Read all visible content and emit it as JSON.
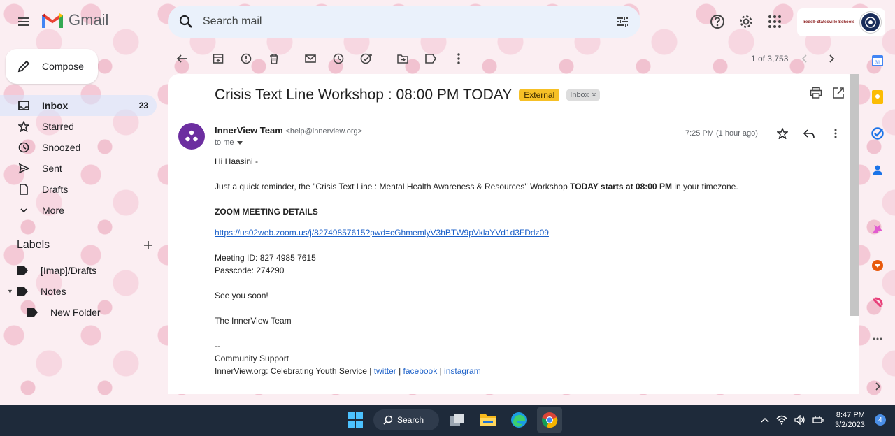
{
  "app": {
    "name": "Gmail"
  },
  "search": {
    "placeholder": "Search mail"
  },
  "account": {
    "school_name": "Iredell-Statesville Schools"
  },
  "nav": {
    "compose_label": "Compose",
    "items": [
      {
        "label": "Inbox",
        "count": "23",
        "icon": "inbox-icon"
      },
      {
        "label": "Starred",
        "icon": "star-icon"
      },
      {
        "label": "Snoozed",
        "icon": "clock-icon"
      },
      {
        "label": "Sent",
        "icon": "send-icon"
      },
      {
        "label": "Drafts",
        "icon": "draft-icon"
      },
      {
        "label": "More",
        "icon": "chevron-down-icon"
      }
    ]
  },
  "labels": {
    "heading": "Labels",
    "items": [
      {
        "label": "[Imap]/Drafts"
      },
      {
        "label": "Notes"
      },
      {
        "label": "New Folder"
      }
    ]
  },
  "pager": {
    "text": "1 of 3,753"
  },
  "email": {
    "subject": "Crisis Text Line Workshop : 08:00 PM TODAY",
    "badge_external": "External",
    "badge_inbox": "Inbox",
    "sender_name": "InnerView Team",
    "sender_email": "<help@innerview.org>",
    "to": "to me",
    "time": "7:25 PM (1 hour ago)",
    "greeting": "Hi Haasini -",
    "reminder_a": "Just a quick reminder, the \"Crisis Text Line : Mental Health Awareness & Resources\" Workshop ",
    "reminder_bold": "TODAY starts at 08:00 PM",
    "reminder_b": " in your timezone.",
    "zoom_heading": "ZOOM MEETING DETAILS",
    "zoom_link": "https://us02web.zoom.us/j/82749857615?pwd=cGhmemlyV3hBTW9pVklaYVd1d3FDdz09",
    "meeting_id": "Meeting ID: 827 4985 7615",
    "passcode": "Passcode: 274290",
    "closing": "See you soon!",
    "team": "The InnerView Team",
    "sig_dash": "--",
    "sig_support": "Community Support",
    "sig_org": "InnerView.org: Celebrating Youth Service | ",
    "sig_twitter": "twitter",
    "sig_sep": " | ",
    "sig_facebook": "facebook",
    "sig_instagram": "instagram"
  },
  "taskbar": {
    "search_label": "Search",
    "time": "8:47 PM",
    "date": "3/2/2023",
    "notifications": "4"
  },
  "colors": {
    "external_badge": "#f6c026",
    "link": "#1a5fc8",
    "taskbar": "#1e2a3a"
  }
}
